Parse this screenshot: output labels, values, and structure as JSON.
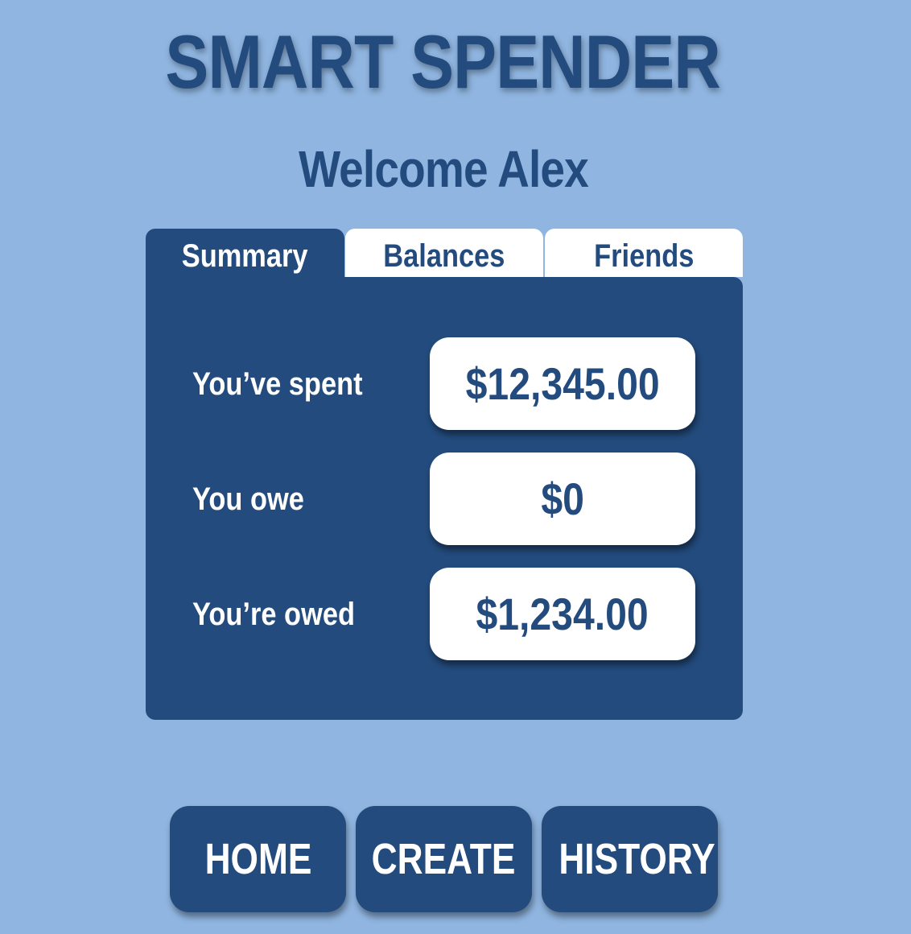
{
  "app": {
    "title": "SMART SPENDER",
    "welcome": "Welcome Alex"
  },
  "tabs": [
    {
      "label": "Summary",
      "active": true
    },
    {
      "label": "Balances",
      "active": false
    },
    {
      "label": "Friends",
      "active": false
    }
  ],
  "summary": {
    "rows": [
      {
        "label": "You’ve spent",
        "value": "$12,345.00"
      },
      {
        "label": "You owe",
        "value": "$0"
      },
      {
        "label": "You’re owed",
        "value": "$1,234.00"
      }
    ]
  },
  "nav": {
    "home": "HOME",
    "create": "CREATE",
    "history": "HISTORY"
  },
  "colors": {
    "background": "#8fb5e0",
    "primary": "#234b7d",
    "surface": "#ffffff"
  }
}
